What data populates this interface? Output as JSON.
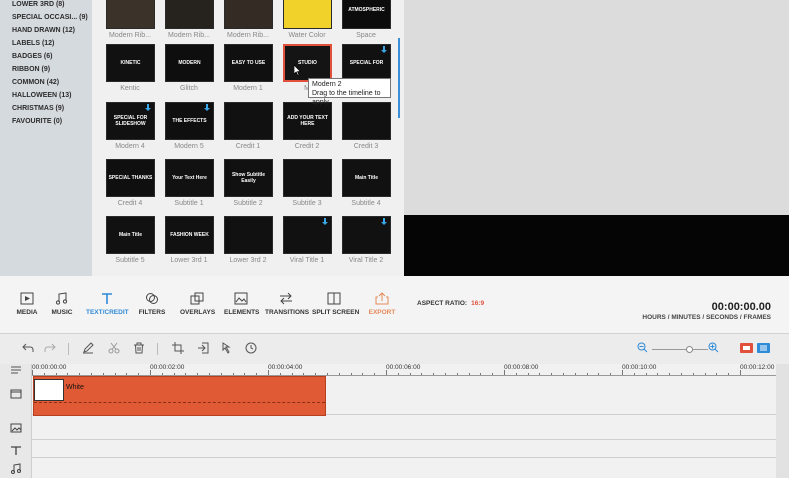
{
  "categories": [
    "LOWER 3RD (8)",
    "SPECIAL OCCASI... (9)",
    "HAND DRAWN (12)",
    "LABELS (12)",
    "BADGES (6)",
    "RIBBON (9)",
    "COMMON (42)",
    "HALLOWEEN (13)",
    "CHRISTMAS (9)",
    "FAVOURITE (0)"
  ],
  "tiles": [
    {
      "caption": "Modern Rib...",
      "text": "",
      "bg": "#3b332a"
    },
    {
      "caption": "Modern Rib...",
      "text": "",
      "bg": "#26221d"
    },
    {
      "caption": "Modern Rib...",
      "text": "",
      "bg": "#332b24"
    },
    {
      "caption": "Water Color",
      "text": "",
      "bg": "#f0d22a"
    },
    {
      "caption": "Space",
      "text": "ATMOSPHERIC",
      "bg": "#0c0c0c"
    },
    {
      "caption": "Kentic",
      "text": "KINETIC",
      "bg": "#111111"
    },
    {
      "caption": "Glitch",
      "text": "MODERN",
      "bg": "#0e0e0e"
    },
    {
      "caption": "Modern 1",
      "text": "EASY TO USE",
      "bg": "#101010"
    },
    {
      "caption": "M",
      "text": "STUDIO",
      "bg": "#141414"
    },
    {
      "caption": "",
      "text": "SPECIAL FOR",
      "bg": "#111111"
    },
    {
      "caption": "Modern 4",
      "text": "SPECIAL FOR SLIDESHOW",
      "bg": "#111111"
    },
    {
      "caption": "Modern 5",
      "text": "THE EFFECTS",
      "bg": "#0f0f0f"
    },
    {
      "caption": "Credit 1",
      "text": "",
      "bg": "#111111"
    },
    {
      "caption": "Credit 2",
      "text": "ADD YOUR TEXT HERE",
      "bg": "#111111"
    },
    {
      "caption": "Credit 3",
      "text": "",
      "bg": "#111111"
    },
    {
      "caption": "Credit 4",
      "text": "SPECIAL THANKS",
      "bg": "#0f0f0f"
    },
    {
      "caption": "Subtitle 1",
      "text": "Your Text Here",
      "bg": "#111111"
    },
    {
      "caption": "Subtitle 2",
      "text": "Show Subtitle Easily",
      "bg": "#111111"
    },
    {
      "caption": "Subtitle 3",
      "text": "",
      "bg": "#111111"
    },
    {
      "caption": "Subtitle 4",
      "text": "Main Title",
      "bg": "#111111"
    },
    {
      "caption": "Subtitle 5",
      "text": "Main Title",
      "bg": "#111111"
    },
    {
      "caption": "Lower 3rd 1",
      "text": "FASHION WEEK",
      "bg": "#111111"
    },
    {
      "caption": "Lower 3rd 2",
      "text": "",
      "bg": "#111111"
    },
    {
      "caption": "Viral Title 1",
      "text": "",
      "bg": "#111111"
    },
    {
      "caption": "Viral Title 2",
      "text": "",
      "bg": "#111111"
    }
  ],
  "tooltip": {
    "title": "Modern 2",
    "hint": "Drag to the timeline to apply"
  },
  "toolbar": {
    "media": "MEDIA",
    "music": "MUSIC",
    "text_credit": "TEXT/CREDIT",
    "filters": "FILTERS",
    "overlays": "OVERLAYS",
    "elements": "ELEMENTS",
    "transitions": "TRANSITIONS",
    "split_screen": "SPLIT SCREEN",
    "export": "EXPORT"
  },
  "aspect_ratio": {
    "label": "ASPECT RATIO:",
    "value": "16:9"
  },
  "timecode": {
    "value": "00:00:00.00",
    "units": "HOURS / MINUTES / SECONDS / FRAMES"
  },
  "ruler": [
    "00:00:00:00",
    "00:00:02:00",
    "00:00:04:00",
    "00:00:06:00",
    "00:00:08:00",
    "00:00:10:00",
    "00:00:12:00"
  ],
  "clip": {
    "label": "White"
  },
  "colors": {
    "accent": "#2f8ad8",
    "clip": "#e05a35",
    "export": "#e58a5a"
  }
}
